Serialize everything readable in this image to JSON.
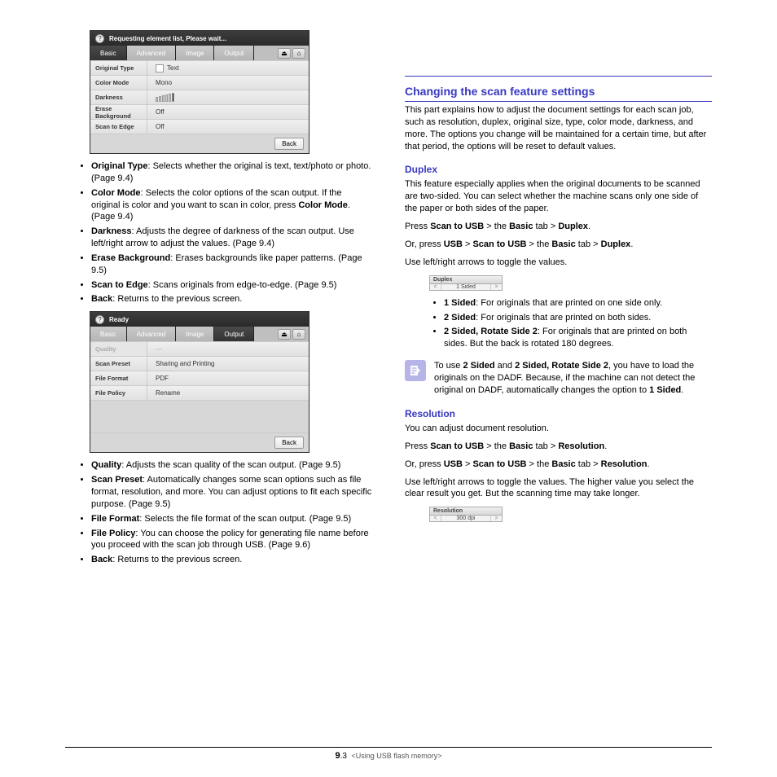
{
  "panel1": {
    "top_text": "Requesting element list, Please wait...",
    "tabs": [
      "Basic",
      "Advanced",
      "Image",
      "Output"
    ],
    "active_tab": 0,
    "rows": [
      {
        "label": "Original Type",
        "value": "Text"
      },
      {
        "label": "Color Mode",
        "value": "Mono"
      },
      {
        "label": "Darkness",
        "value": ""
      },
      {
        "label": "Erase Background",
        "value": "Off"
      },
      {
        "label": "Scan to Edge",
        "value": "Off"
      }
    ],
    "back": "Back"
  },
  "panel2": {
    "top_text": "Ready",
    "tabs": [
      "Basic",
      "Advanced",
      "Image",
      "Output"
    ],
    "active_tab": 3,
    "rows": [
      {
        "label": "Quality",
        "value": "—",
        "dim": true
      },
      {
        "label": "Scan Preset",
        "value": "Sharing and Printing"
      },
      {
        "label": "File Format",
        "value": "PDF"
      },
      {
        "label": "File Policy",
        "value": "Rename"
      }
    ],
    "back": "Back"
  },
  "left_bullets1": [
    {
      "term": "Original Type",
      "desc": ": Selects whether the original is text, text/photo or photo. (Page 9.4)"
    },
    {
      "term": "Color Mode",
      "desc": ": Selects the color options of the scan output. If the original is color and you want to scan in color, press ",
      "tail": "Color Mode",
      "after": ". (Page 9.4)"
    },
    {
      "term": "Darkness",
      "desc": ": Adjusts the degree of darkness of the scan output. Use left/right arrow to adjust the values. (Page 9.4)"
    },
    {
      "term": "Erase Background",
      "desc": ": Erases backgrounds like paper patterns. (Page 9.5)"
    },
    {
      "term": "Scan to Edge",
      "desc": ": Scans originals from edge-to-edge. (Page 9.5)"
    },
    {
      "term": "Back",
      "desc": ": Returns to the previous screen."
    }
  ],
  "left_bullets2": [
    {
      "term": "Quality",
      "desc": ": Adjusts the scan quality of the scan output. (Page 9.5)"
    },
    {
      "term": "Scan Preset",
      "desc": ": Automatically changes some scan options such as file format, resolution, and more. You can adjust options to fit each specific purpose. (Page 9.5)"
    },
    {
      "term": "File Format",
      "desc": ": Selects the file format of the scan output. (Page 9.5)"
    },
    {
      "term": "File Policy",
      "desc": ": You can choose the policy for generating file name before you proceed with the scan job through USB. (Page 9.6)"
    },
    {
      "term": "Back",
      "desc": ": Returns to the previous screen."
    }
  ],
  "right": {
    "heading": "Changing the scan feature settings",
    "intro": "This part explains how to adjust the document settings for each scan job, such as resolution, duplex, original size, type, color mode, darkness, and more. The options you change will be maintained for a certain time, but after that period, the options will be reset to default values.",
    "duplex": {
      "title": "Duplex",
      "desc": "This feature especially applies when the original documents to be scanned are two-sided. You can select whether the machine scans only one side of the paper or both sides of the paper.",
      "nav1": {
        "a": "Press ",
        "b": "Scan to USB",
        "c": " > the ",
        "d": "Basic",
        "e": " tab > ",
        "f": "Duplex",
        "g": "."
      },
      "nav2": {
        "a": "Or, press ",
        "b": "USB",
        "c": " > ",
        "d": "Scan to USB",
        "e": " > the ",
        "f": "Basic",
        "g": " tab > ",
        "h": "Duplex",
        "i": "."
      },
      "toggle_text": "Use left/right arrows to toggle the values.",
      "mini_head": "Duplex",
      "mini_value": "1 Sided",
      "items": [
        {
          "term": "1 Sided",
          "desc": ": For originals that are printed on one side only."
        },
        {
          "term": "2 Sided",
          "desc": ": For originals that are printed on both sides."
        },
        {
          "term": "2 Sided, Rotate Side 2",
          "desc": ": For originals that are printed on both sides. But the back is rotated 180 degrees."
        }
      ],
      "note_a": "To use ",
      "note_b": "2 Sided",
      "note_c": " and ",
      "note_d": "2 Sided, Rotate Side 2",
      "note_e": ", you have to load the originals on the DADF. Because, if the machine can not detect the original on DADF, automatically changes the option to ",
      "note_f": "1 Sided",
      "note_g": "."
    },
    "resolution": {
      "title": "Resolution",
      "desc": "You can adjust document resolution.",
      "nav1": {
        "a": "Press ",
        "b": "Scan to USB",
        "c": " > the ",
        "d": "Basic",
        "e": " tab > ",
        "f": "Resolution",
        "g": "."
      },
      "nav2": {
        "a": "Or, press ",
        "b": "USB",
        "c": " > ",
        "d": "Scan to USB",
        "e": " > the ",
        "f": "Basic",
        "g": " tab > ",
        "h": "Resolution",
        "i": "."
      },
      "toggle_text": "Use left/right arrows to toggle the values. The higher value you select the clear result you get. But the scanning time may take longer.",
      "mini_head": "Resolution",
      "mini_value": "300 dpi"
    }
  },
  "footer": {
    "page_prefix": "9",
    "page_num": ".3",
    "caption": "<Using USB flash memory>"
  }
}
